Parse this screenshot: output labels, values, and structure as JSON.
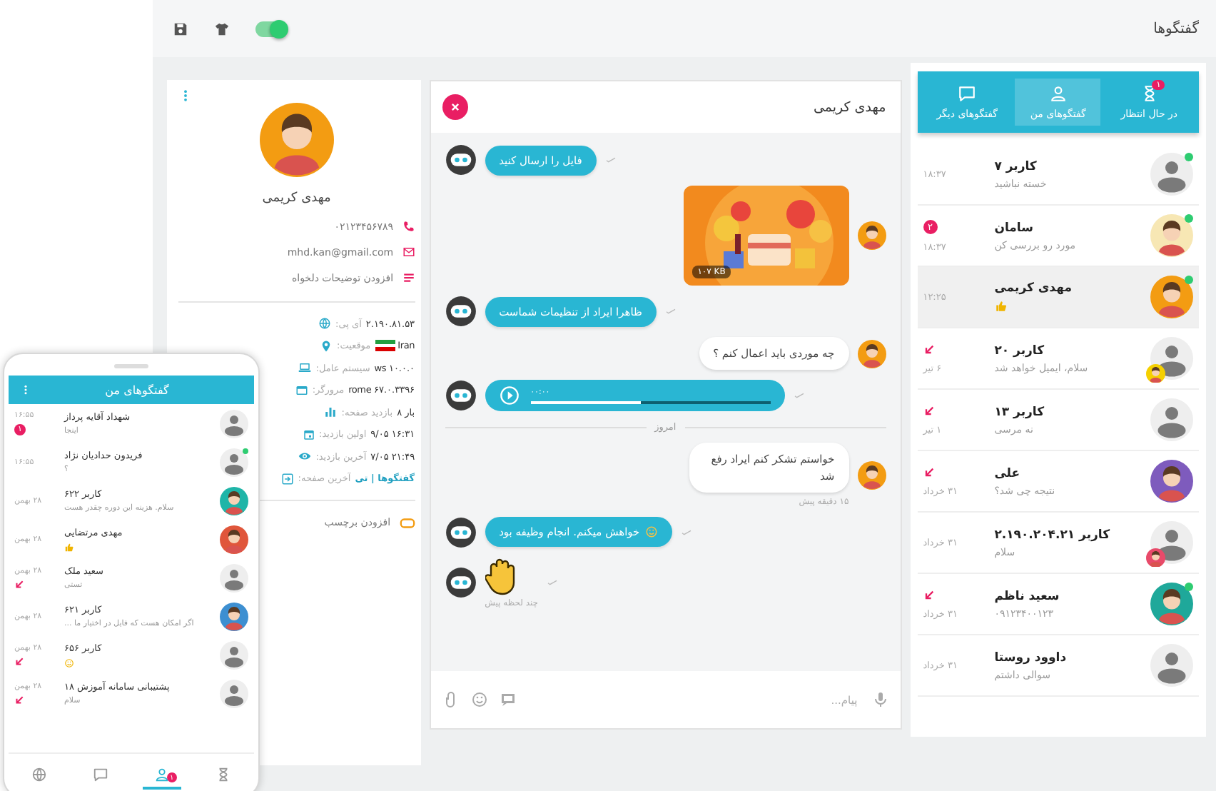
{
  "header": {
    "title": "گفتگوها",
    "toggle_on": true
  },
  "chat_list": {
    "tabs": [
      {
        "label": "در حال انتظار",
        "kind": "waiting",
        "badge": "۱",
        "selected": false
      },
      {
        "label": "گفتگوهای من",
        "kind": "mine",
        "selected": true
      },
      {
        "label": "گفتگوهای دیگر",
        "kind": "others",
        "selected": false
      }
    ],
    "items": [
      {
        "name": "کاربر ۷",
        "preview": "خسته نباشید",
        "time": "۱۸:۳۷",
        "avatar": {
          "kind": "default"
        },
        "online": true,
        "selected": false,
        "replied": false
      },
      {
        "name": "سامان",
        "preview": "مورد رو بررسی کن",
        "time": "۱۸:۳۷",
        "avatar": {
          "kind": "person",
          "color": "#f7e7b4"
        },
        "online": true,
        "selected": false,
        "replied": false,
        "badge": "۲"
      },
      {
        "name": "مهدی کریمی",
        "kind": "thumb",
        "time": "۱۲:۲۵",
        "avatar": {
          "kind": "person",
          "color": "#f39c12"
        },
        "online": true,
        "selected": true,
        "replied": false
      },
      {
        "name": "کاربر ۲۰",
        "preview": "سلام، ایمیل خواهد شد",
        "time": "۶ تیر",
        "avatar": {
          "kind": "default"
        },
        "agent": {
          "kind": "person",
          "color": "#f5d000"
        },
        "online": false,
        "selected": false,
        "replied": true
      },
      {
        "name": "کاربر ۱۳",
        "preview": "نه مرسی",
        "time": "۱ تیر",
        "avatar": {
          "kind": "default"
        },
        "online": false,
        "selected": false,
        "replied": true
      },
      {
        "name": "علی",
        "preview": "نتیجه چی شد؟",
        "time": "۳۱ خرداد",
        "avatar": {
          "kind": "person",
          "color": "#7e5bbd"
        },
        "online": false,
        "selected": false,
        "replied": true
      },
      {
        "name": "کاربر ۲.۱۹۰.۲۰۴.۲۱",
        "preview": "سلام",
        "time": "۳۱ خرداد",
        "avatar": {
          "kind": "default"
        },
        "agent": {
          "kind": "person",
          "color": "#e84a6a"
        },
        "online": false,
        "selected": false,
        "replied": false
      },
      {
        "name": "سعید ناظم",
        "preview": "۰۹۱۲۳۴۰۰۱۲۳",
        "time": "۳۱ خرداد",
        "avatar": {
          "kind": "person",
          "color": "#1fa89a"
        },
        "online": true,
        "selected": false,
        "replied": true
      },
      {
        "name": "داوود روستا",
        "preview": "سوالی داشتم",
        "time": "۳۱ خرداد",
        "avatar": {
          "kind": "default"
        },
        "online": false,
        "selected": false,
        "replied": false
      }
    ]
  },
  "chat": {
    "title": "مهدی کریمی",
    "messages": [
      {
        "kind": "bot_text",
        "text": "فایل را ارسال کنید"
      },
      {
        "kind": "user_image",
        "caption": "۱۰۷ KB"
      },
      {
        "kind": "bot_text",
        "text": "ظاهرا ایراد از تنظیمات شماست"
      },
      {
        "kind": "user_text",
        "text": "چه موردی باید اعمال کنم ؟"
      },
      {
        "kind": "bot_voice",
        "duration": "۰۰:۰۰",
        "level": 0.46
      },
      {
        "kind": "divider",
        "text": "امروز"
      },
      {
        "kind": "user_text",
        "text": "خواستم تشکر کنم ایراد رفع شد",
        "time": "۱۵ دقیقه پیش"
      },
      {
        "kind": "bot_text",
        "text": "خواهش میکنم. انجام وظیفه بود",
        "emoji": true
      },
      {
        "kind": "bot_sticker",
        "time": "چند لحظه پیش"
      }
    ],
    "placeholder": "پیام..."
  },
  "profile": {
    "name": "مهدی کریمی",
    "contacts": [
      {
        "kind": "phone",
        "text": "۰۲۱۲۳۴۵۶۷۸۹"
      },
      {
        "kind": "email",
        "text": "mhd.kan@gmail.com"
      },
      {
        "kind": "note",
        "text": "افزودن توضیحات دلخواه"
      }
    ],
    "info": [
      {
        "label": "آی پی:",
        "value": "۲.۱۹۰.۸۱.۵۳",
        "kind": "text"
      },
      {
        "label": "موقعیت:",
        "value": "Iran",
        "kind": "flag"
      },
      {
        "label": "سیستم عامل:",
        "value": "ws ۱۰.۰.۰",
        "kind": "text"
      },
      {
        "label": "مرورگر:",
        "value": "rome ۶۷.۰.۳۳۹۶",
        "kind": "text"
      },
      {
        "label": "بازدید صفحه:",
        "value": "۸ بار",
        "kind": "text"
      },
      {
        "label": "اولین بازدید:",
        "value": "۹/۰۵ ۱۶:۳۱",
        "kind": "text"
      },
      {
        "label": "آخرین بازدید:",
        "value": "۷/۰۵ ۲۱:۴۹",
        "kind": "text"
      },
      {
        "label": "آخرین صفحه:",
        "value": "گفتگوها | تی",
        "kind": "link"
      }
    ],
    "tag_label": "افزودن برچسب"
  },
  "phone": {
    "title": "گفتگوهای من",
    "items": [
      {
        "name": "شهداد آقایه پرداز",
        "preview": "اینجا",
        "time": "۱۶:۵۵",
        "avatar": {
          "kind": "default"
        },
        "badge": "۱",
        "online": false,
        "replied": false
      },
      {
        "name": "فریدون حدادیان نژاد",
        "preview": "؟",
        "time": "۱۶:۵۵",
        "avatar": {
          "kind": "default"
        },
        "online": true,
        "replied": false
      },
      {
        "name": "کاربر ۶۲۲",
        "preview": "سلام. هزینه این دوره چقدر هست",
        "time": "۲۸ بهمن",
        "avatar": {
          "kind": "person",
          "color": "#1fb5a8"
        },
        "online": false,
        "replied": false
      },
      {
        "name": "مهدی مرتضایی",
        "kind": "thumb",
        "time": "۲۸ بهمن",
        "avatar": {
          "kind": "person",
          "color": "#e0563b"
        },
        "online": false,
        "replied": false
      },
      {
        "name": "سعید ملک",
        "preview": "تستی",
        "time": "۲۸ بهمن",
        "avatar": {
          "kind": "default"
        },
        "online": false,
        "replied": true
      },
      {
        "name": "کاربر ۶۲۱",
        "preview": "اگر امکان هست که فایل در اختیار ما ...",
        "time": "۲۸ بهمن",
        "avatar": {
          "kind": "person",
          "color": "#3d8fd1"
        },
        "online": false,
        "replied": false
      },
      {
        "name": "کاربر ۶۵۶",
        "kind": "smile",
        "time": "۲۸ بهمن",
        "avatar": {
          "kind": "default"
        },
        "online": false,
        "replied": true
      },
      {
        "name": "پشتیبانی سامانه آموزش ۱۸",
        "preview": "سلام",
        "time": "۲۸ بهمن",
        "avatar": {
          "kind": "default"
        },
        "online": false,
        "replied": true
      }
    ],
    "nav": [
      {
        "kind": "others",
        "selected": false
      },
      {
        "kind": "chats",
        "selected": false
      },
      {
        "kind": "mine",
        "badge": "۱",
        "selected": true
      },
      {
        "kind": "waiting",
        "selected": false
      }
    ]
  }
}
